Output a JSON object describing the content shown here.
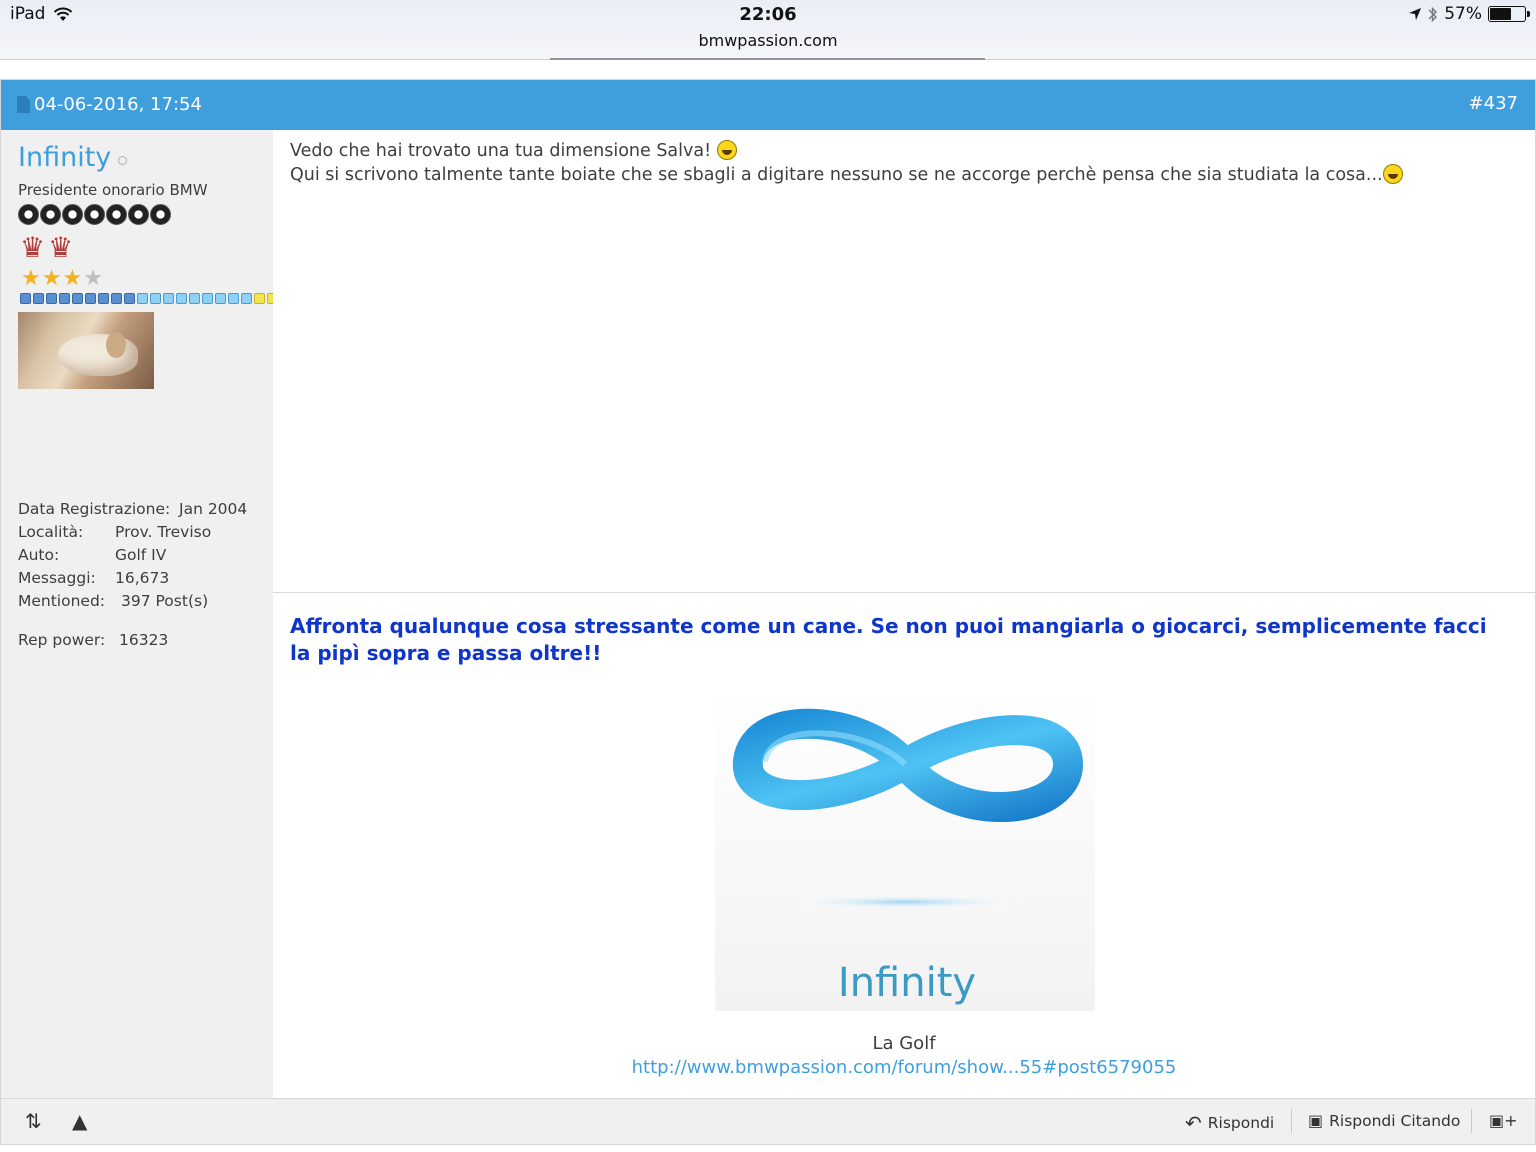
{
  "status_bar": {
    "device": "iPad",
    "time": "22:06",
    "url": "bmwpassion.com",
    "battery": "57%"
  },
  "post": {
    "date": "04-06-2016, 17:54",
    "number": "#437",
    "user": {
      "name": "Infinity",
      "title": "Presidente onorario BMW",
      "rep_power_label": "Rep power:",
      "rep_power_value": "16323",
      "info": [
        {
          "label": "Data Registrazione:",
          "value": "Jan 2004"
        },
        {
          "label": "Località:",
          "value": "Prov. Treviso"
        },
        {
          "label": "Auto:",
          "value": "Golf IV"
        },
        {
          "label": "Messaggi:",
          "value": "16,673"
        },
        {
          "label": "Mentioned:",
          "value": "397 Post(s)"
        }
      ]
    },
    "message": {
      "line1": "Vedo che hai trovato una tua dimensione Salva!",
      "line2": "Qui si scrivono talmente tante boiate che se sbagli a digitare nessuno se ne accorge perchè pensa che sia studiata la cosa..."
    },
    "signature": {
      "quote": "Affronta qualunque cosa stressante come un cane. Se non puoi mangiarla o giocarci, semplicemente facci la pipì sopra e passa oltre!!",
      "image_text": "Infinity",
      "caption": "La Golf",
      "link": "http://www.bmwpassion.com/forum/show...55#post6579055"
    },
    "footer": {
      "reply": "Rispondi",
      "reply_quote": "Rispondi Citando"
    }
  },
  "colors": {
    "header_blue": "#3f9fdc",
    "quote_blue": "#0f35c9",
    "sidebar_bg": "#f0f0f0"
  }
}
